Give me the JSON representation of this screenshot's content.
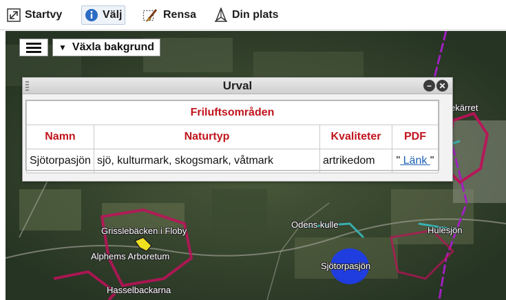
{
  "toolbar": {
    "startvy": "Startvy",
    "valj": "Välj",
    "rensa": "Rensa",
    "din_plats": "Din plats"
  },
  "map": {
    "background_button": "Växla bakgrund",
    "labels": {
      "ekarret": "ekärret",
      "grisslebacken": "Grisslebäcken i Floby",
      "alphems": "Alphems Arboretum",
      "hasselbackarna": "Hasselbackarna",
      "odens_kulle": "Odens kulle",
      "hulesjon": "Hulesjön",
      "sjotorpasjon": "Sjötorpasjön"
    }
  },
  "dialog": {
    "title": "Urval",
    "table": {
      "title": "Friluftsområden",
      "columns": [
        "Namn",
        "Naturtyp",
        "Kvaliteter",
        "PDF"
      ],
      "rows": [
        {
          "namn": "Sjötorpasjön",
          "naturtyp": "sjö, kulturmark, skogsmark, våtmark",
          "kvaliteter": "artrikedom",
          "pdf_prefix": "\"",
          "pdf_link": " Länk ",
          "pdf_suffix": "\""
        }
      ]
    }
  },
  "colors": {
    "header_red": "#c0141c",
    "link_blue": "#1a5fb4",
    "route_purple": "#a020c0",
    "highlight_blue": "#1f3ce8"
  }
}
